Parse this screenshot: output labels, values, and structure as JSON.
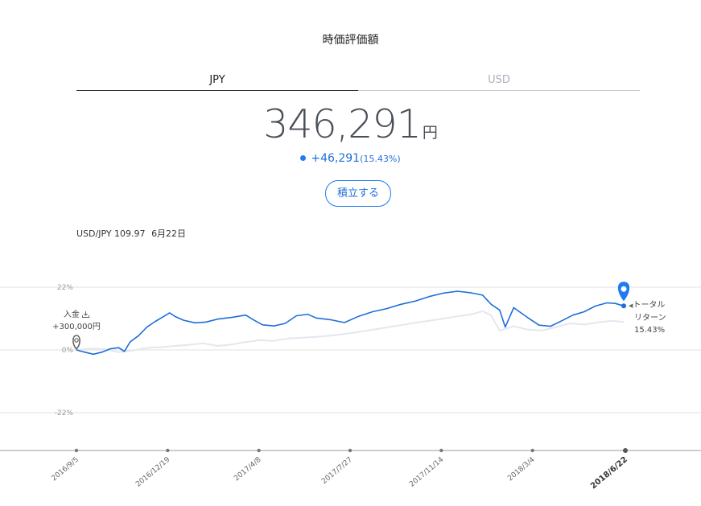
{
  "header": {
    "title": "時価評価額"
  },
  "tabs": [
    {
      "label": "JPY",
      "active": true
    },
    {
      "label": "USD",
      "active": false
    }
  ],
  "valuation": {
    "amount": "346,291",
    "unit": "円",
    "change": "+46,291",
    "change_pct": "(15.43%)"
  },
  "actions": {
    "invest_label": "積立する"
  },
  "fx": {
    "pair": "USD/JPY 109.97",
    "date": "6月22日"
  },
  "deposit": {
    "label": "入金",
    "icon": "deposit-icon",
    "amount": "+300,000円"
  },
  "total_return": {
    "line1": "トータル",
    "line2": "リターン",
    "value": "15.43%"
  },
  "colors": {
    "accent": "#1e6fd9",
    "benchmark": "#e4e7ee",
    "grid": "#e6e6e6"
  },
  "chart_data": {
    "type": "line",
    "y_ticks": [
      "22%",
      "0%",
      "-22%"
    ],
    "ylim": [
      -22,
      22
    ],
    "x_ticks": [
      "2016/9/5",
      "2016/12/19",
      "2017/4/8",
      "2017/7/27",
      "2017/11/14",
      "2018/3/4",
      "2018/6/22"
    ],
    "highlight_x": "2018/6/22",
    "series": [
      {
        "color": "#1e6fd9",
        "points": [
          [
            0,
            0
          ],
          [
            3,
            -0.8
          ],
          [
            6,
            -1.5
          ],
          [
            9,
            -0.8
          ],
          [
            12,
            0.4
          ],
          [
            15,
            0.8
          ],
          [
            17,
            -0.5
          ],
          [
            19,
            2.8
          ],
          [
            22,
            5
          ],
          [
            25,
            8
          ],
          [
            28,
            10
          ],
          [
            31,
            11.8
          ],
          [
            33,
            13
          ],
          [
            35,
            11.7
          ],
          [
            38,
            10.4
          ],
          [
            42,
            9.5
          ],
          [
            46,
            9.8
          ],
          [
            50,
            10.8
          ],
          [
            55,
            11.4
          ],
          [
            60,
            12.2
          ],
          [
            63,
            10.4
          ],
          [
            66,
            8.8
          ],
          [
            70,
            8.4
          ],
          [
            74,
            9.3
          ],
          [
            78,
            12
          ],
          [
            82,
            12.5
          ],
          [
            85,
            11.2
          ],
          [
            90,
            10.6
          ],
          [
            95,
            9.6
          ],
          [
            100,
            11.8
          ],
          [
            105,
            13.4
          ],
          [
            110,
            14.5
          ],
          [
            115,
            16
          ],
          [
            120,
            17.1
          ],
          [
            125,
            18.7
          ],
          [
            130,
            19.9
          ],
          [
            135,
            20.6
          ],
          [
            140,
            20
          ],
          [
            144,
            19.2
          ],
          [
            147,
            16
          ],
          [
            150,
            14
          ],
          [
            152,
            8
          ],
          [
            155,
            14.8
          ],
          [
            160,
            11.3
          ],
          [
            164,
            8.7
          ],
          [
            168,
            8.3
          ],
          [
            172,
            10.2
          ],
          [
            176,
            12.2
          ],
          [
            180,
            13.4
          ],
          [
            184,
            15.4
          ],
          [
            188,
            16.5
          ],
          [
            191,
            16.3
          ],
          [
            194,
            15.43
          ]
        ]
      },
      {
        "color": "#e4e7ee",
        "points": [
          [
            0,
            0
          ],
          [
            5,
            0.5
          ],
          [
            10,
            0.3
          ],
          [
            15,
            -0.8
          ],
          [
            20,
            -0.2
          ],
          [
            25,
            0.7
          ],
          [
            30,
            1
          ],
          [
            35,
            1.4
          ],
          [
            40,
            1.8
          ],
          [
            45,
            2.3
          ],
          [
            50,
            1.4
          ],
          [
            55,
            1.9
          ],
          [
            60,
            2.8
          ],
          [
            65,
            3.4
          ],
          [
            70,
            3.2
          ],
          [
            75,
            4
          ],
          [
            80,
            4.3
          ],
          [
            85,
            4.6
          ],
          [
            90,
            5
          ],
          [
            95,
            5.6
          ],
          [
            100,
            6.3
          ],
          [
            105,
            7.1
          ],
          [
            110,
            7.9
          ],
          [
            115,
            8.7
          ],
          [
            120,
            9.5
          ],
          [
            125,
            10.2
          ],
          [
            130,
            11
          ],
          [
            135,
            11.8
          ],
          [
            140,
            12.5
          ],
          [
            144,
            13.6
          ],
          [
            147,
            12.1
          ],
          [
            150,
            6.7
          ],
          [
            152,
            7.4
          ],
          [
            155,
            8.3
          ],
          [
            160,
            7.1
          ],
          [
            165,
            6.8
          ],
          [
            170,
            8
          ],
          [
            175,
            9.3
          ],
          [
            180,
            8.9
          ],
          [
            185,
            9.7
          ],
          [
            190,
            10.2
          ],
          [
            194,
            9.8
          ]
        ]
      }
    ]
  }
}
